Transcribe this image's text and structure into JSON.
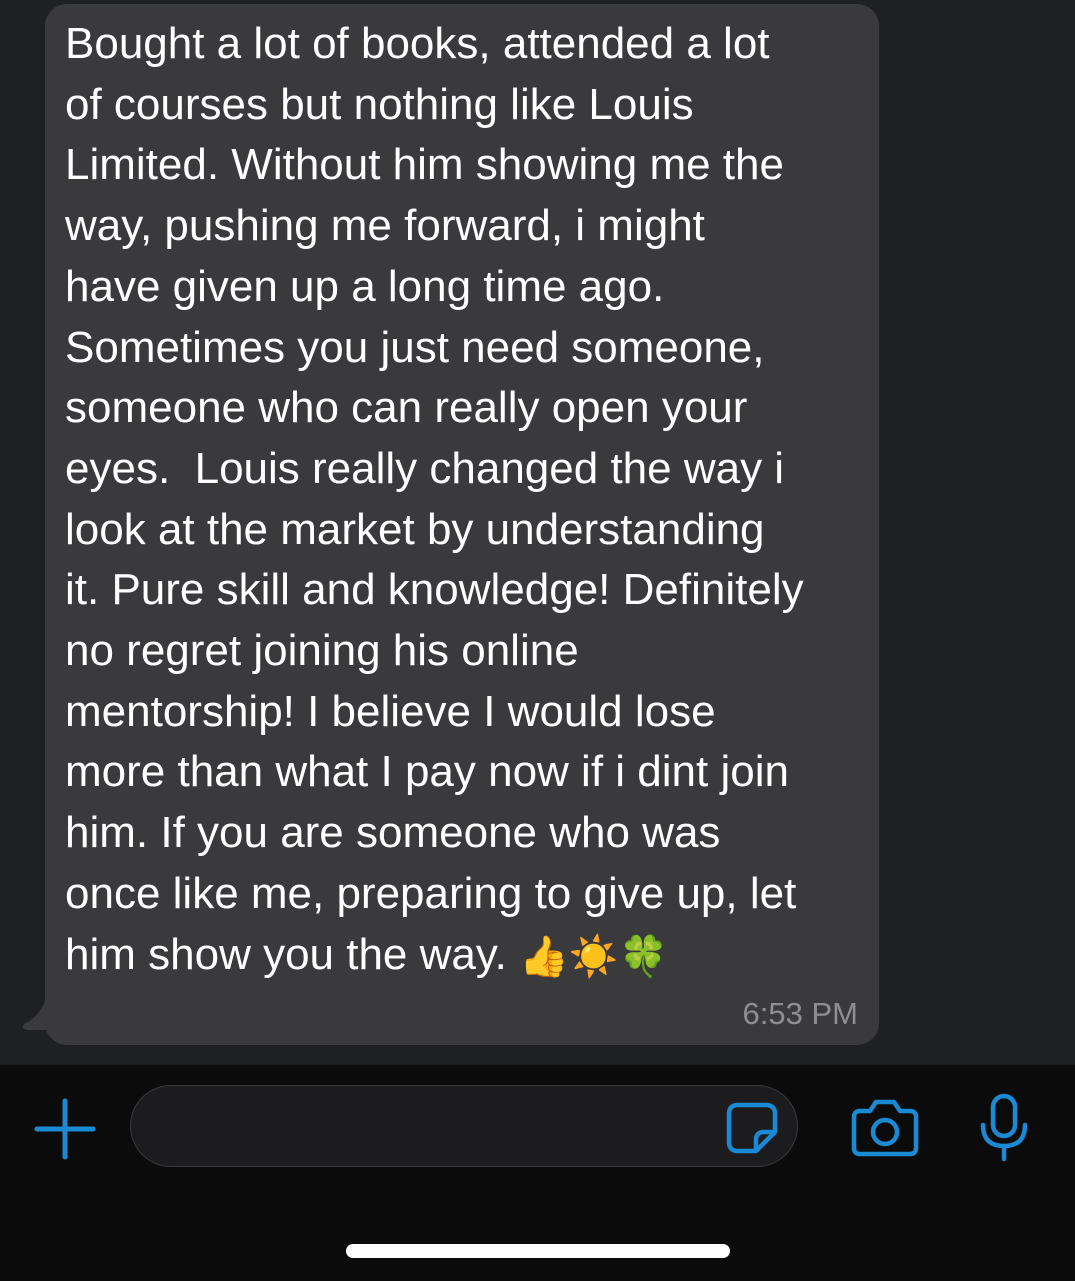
{
  "message": {
    "lines": [
      "Bought a lot of books, attended a lot",
      "of courses but nothing like Louis",
      "Limited. Without him showing me the",
      "way, pushing me forward, i might",
      "have given up a long time ago.",
      "Sometimes you just need someone,",
      "someone who can really open your",
      "eyes.  Louis really changed the way i",
      "look at the market by understanding",
      "it. Pure skill and knowledge! Definitely",
      "no regret joining his online",
      "mentorship! I believe I would lose",
      "more than what I pay now if i dint join",
      "him. If you are someone who was",
      "once like me, preparing to give up, let",
      "him show you the way. "
    ],
    "emojis": [
      "👍",
      "☀️",
      "🍀"
    ],
    "time": "6:53 PM"
  },
  "composer": {
    "value": "",
    "placeholder": ""
  },
  "colors": {
    "chat_background": "#1f2023",
    "bubble": "#3a3a3c",
    "accent": "#1a8ad4"
  },
  "icons": [
    "plus-icon",
    "sticker-icon",
    "camera-icon",
    "microphone-icon"
  ]
}
